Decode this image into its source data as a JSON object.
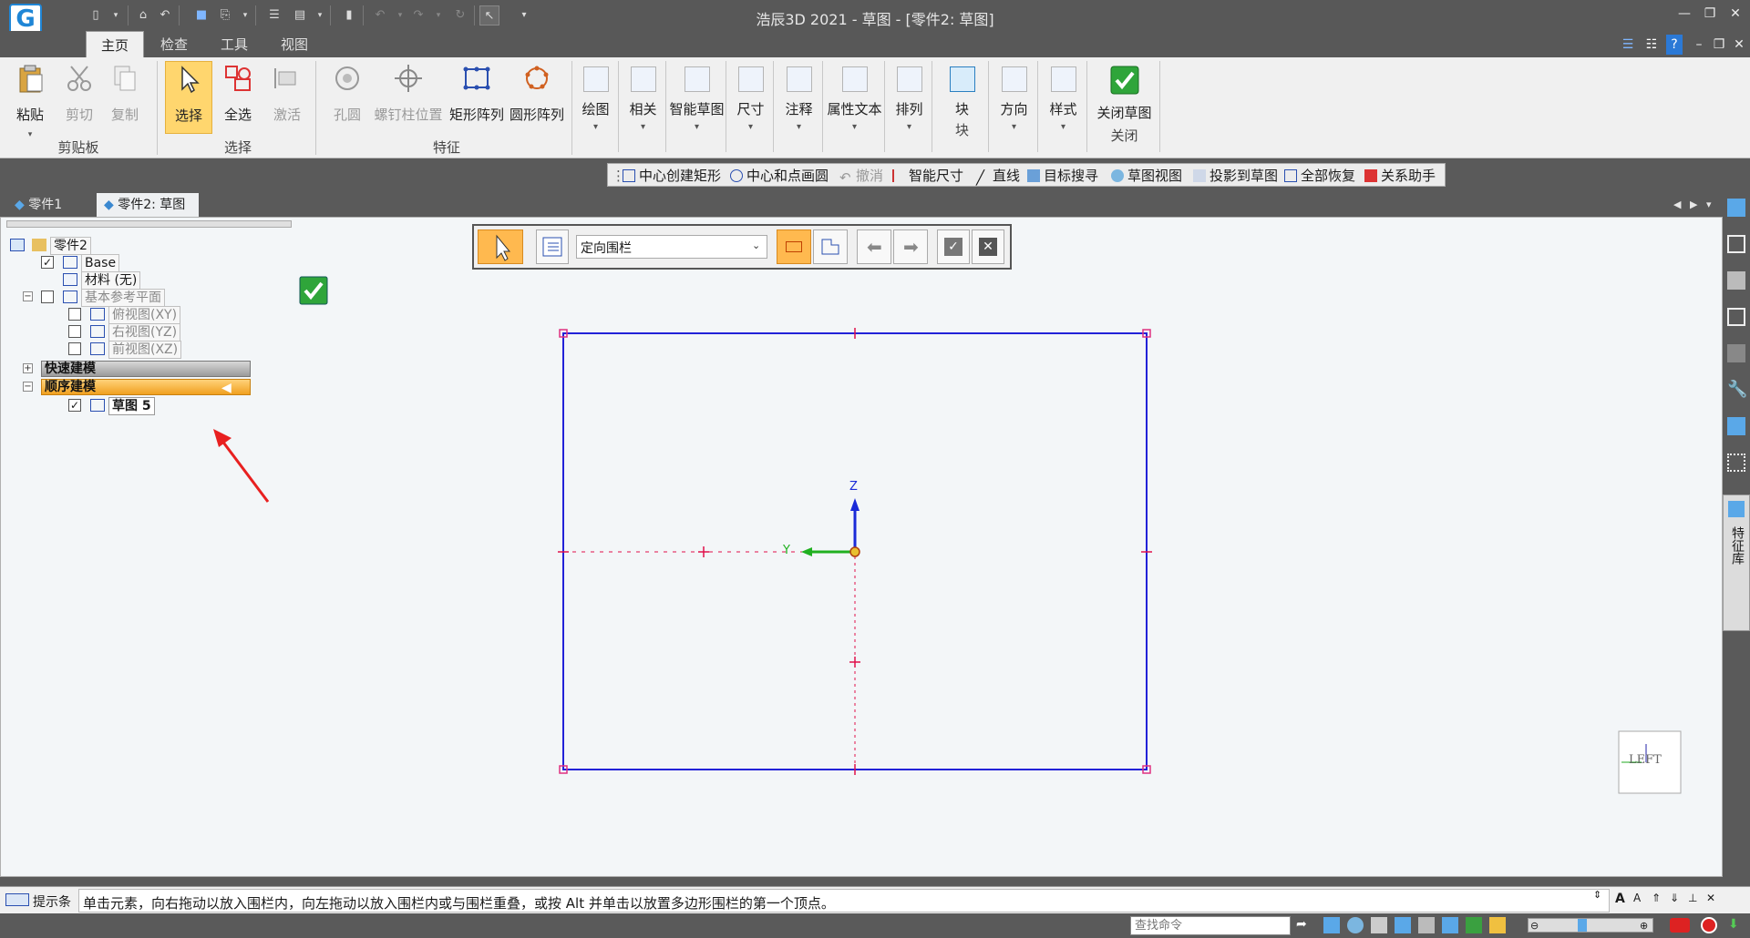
{
  "title_bar": {
    "title": "浩辰3D 2021 - 草图 - [零件2: 草图]"
  },
  "ribbon_tabs": [
    "主页",
    "检查",
    "工具",
    "视图"
  ],
  "clipboard": {
    "paste": "粘贴",
    "cut": "剪切",
    "copy": "复制",
    "group": "剪贴板"
  },
  "select": {
    "select": "选择",
    "select_all": "全选",
    "activate": "激活",
    "group": "选择"
  },
  "feature": {
    "hole": "孔圆",
    "screw": "螺钉柱位置",
    "rect_array": "矩形阵列",
    "circ_array": "圆形阵列",
    "group": "特征"
  },
  "draw_buttons": [
    "绘图",
    "相关",
    "智能草图",
    "尺寸",
    "注释",
    "属性文本",
    "排列"
  ],
  "block": {
    "label": "块",
    "group": "块"
  },
  "direction": "方向",
  "style": "样式",
  "close": {
    "label": "关闭草图",
    "group": "关闭"
  },
  "command_bar": [
    "中心创建矩形",
    "中心和点画圆",
    "撤消",
    "智能尺寸",
    "直线",
    "目标搜寻",
    "草图视图",
    "投影到草图",
    "全部恢复",
    "关系助手"
  ],
  "doc_tabs": [
    "零件1",
    "零件2: 草图"
  ],
  "tree": {
    "root": "零件2",
    "base": "Base",
    "material": "材料 (无)",
    "ref_planes": "基本参考平面",
    "top_view": "俯视图(XY)",
    "right_view": "右视图(YZ)",
    "front_view": "前视图(XZ)",
    "quick_model": "快速建模",
    "seq_model": "顺序建模",
    "sketch": "草图 5"
  },
  "sel_toolbar": {
    "mode": "定向围栏"
  },
  "axes": {
    "z": "Z",
    "y": "Y"
  },
  "view_cube": "LEFT",
  "side_panel_label": "特征库",
  "status": {
    "prompt_label": "提示条",
    "prompt": "单击元素，向右拖动以放入围栏内，向左拖动以放入围栏内或与围栏重叠，或按 Alt 并单击以放置多边形围栏的第一个顶点。",
    "search_placeholder": "查找命令"
  }
}
